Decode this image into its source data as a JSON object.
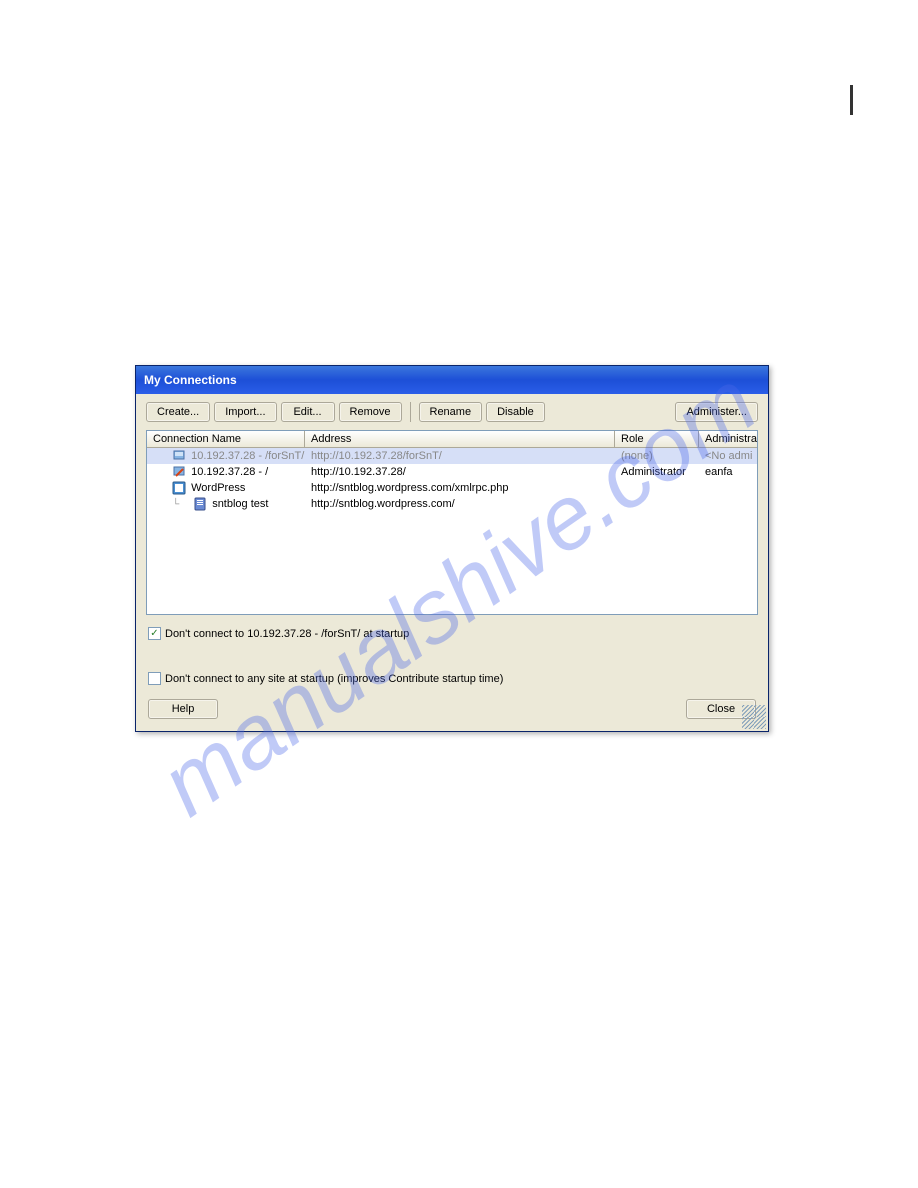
{
  "watermark": "manualshive.com",
  "dialog": {
    "title": "My Connections",
    "toolbar": {
      "create_label": "Create...",
      "import_label": "Import...",
      "edit_label": "Edit...",
      "remove_label": "Remove",
      "rename_label": "Rename",
      "disable_label": "Disable",
      "administer_label": "Administer..."
    },
    "table": {
      "columns": {
        "name": "Connection Name",
        "address": "Address",
        "role": "Role",
        "admin": "Administra"
      },
      "rows": [
        {
          "name": "10.192.37.28 - /forSnT/",
          "address": "http://10.192.37.28/forSnT/",
          "role": "(none)",
          "admin": "<No admi",
          "selected": true,
          "inactive": true,
          "icon": "server-disabled"
        },
        {
          "name": "10.192.37.28 - /",
          "address": "http://10.192.37.28/",
          "role": "Administrator",
          "admin": "eanfa",
          "selected": false,
          "inactive": false,
          "icon": "server-edit"
        },
        {
          "name": "WordPress",
          "address": "http://sntblog.wordpress.com/xmlrpc.php",
          "role": "",
          "admin": "",
          "selected": false,
          "inactive": false,
          "icon": "wordpress",
          "indent": 0
        },
        {
          "name": "sntblog test",
          "address": "http://sntblog.wordpress.com/",
          "role": "",
          "admin": "",
          "selected": false,
          "inactive": false,
          "icon": "blog-entry",
          "indent": 1,
          "tree": true
        }
      ]
    },
    "checkboxes": {
      "startup_specific": {
        "checked": true,
        "label": "Don't connect to 10.192.37.28 - /forSnT/ at startup"
      },
      "startup_all": {
        "checked": false,
        "label": "Don't connect to any site at startup (improves Contribute startup time)"
      }
    },
    "buttons": {
      "help_label": "Help",
      "close_label": "Close"
    }
  }
}
